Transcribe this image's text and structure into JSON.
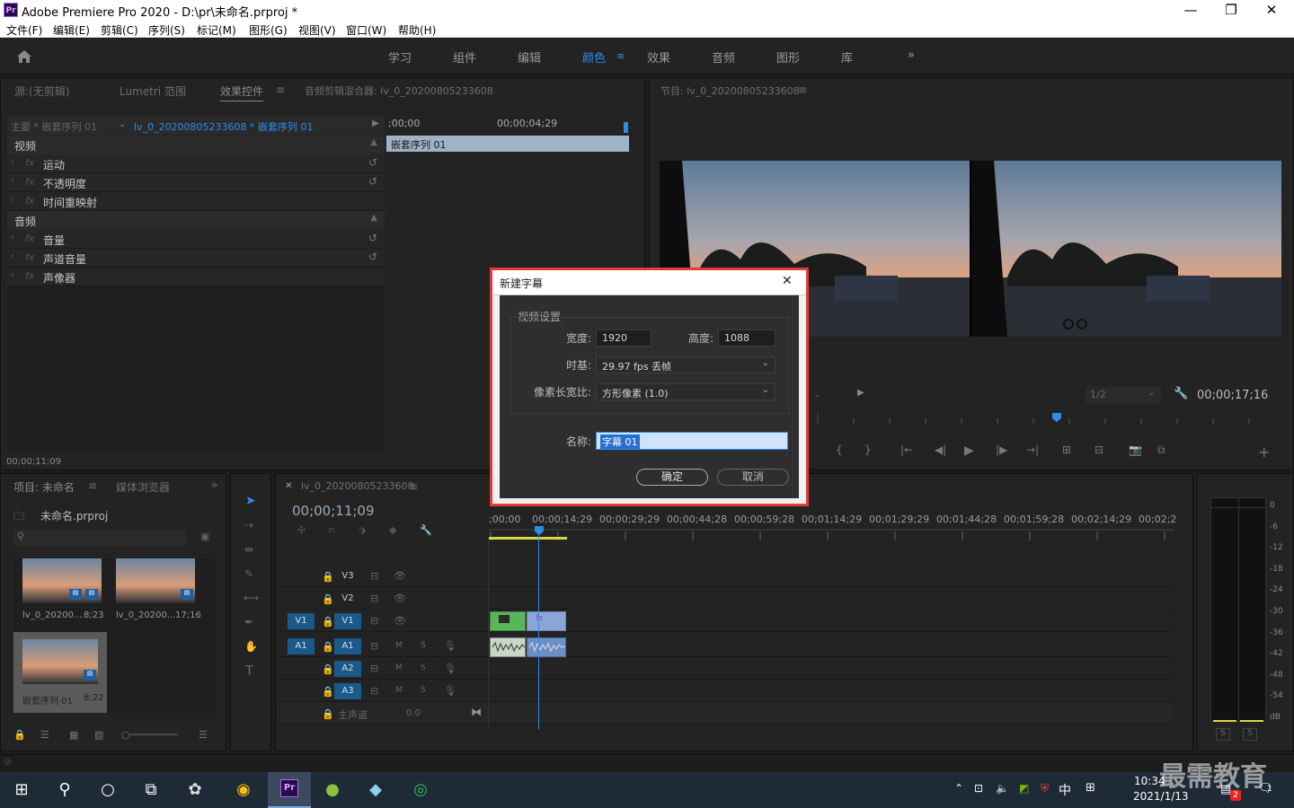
{
  "window": {
    "app_icon": "Pr",
    "title": "Adobe Premiere Pro 2020 - D:\\pr\\未命名.prproj *",
    "minimize": "—",
    "restore": "❐",
    "close": "✕"
  },
  "menu": [
    "文件(F)",
    "编辑(E)",
    "剪辑(C)",
    "序列(S)",
    "标记(M)",
    "图形(G)",
    "视图(V)",
    "窗口(W)",
    "帮助(H)"
  ],
  "workspaces": {
    "home_icon": "home-icon",
    "items": [
      "学习",
      "组件",
      "编辑",
      "颜色",
      "效果",
      "音频",
      "图形",
      "库"
    ],
    "active": "颜色",
    "more": "»"
  },
  "source_panel": {
    "tabs": [
      "源:(无剪辑)",
      "Lumetri 范围",
      "效果控件",
      "音频剪辑混合器: lv_0_20200805233608"
    ],
    "active_tab": "效果控件",
    "master_label": "主要 * 嵌套序列 01",
    "clip_label": "lv_0_20200805233608 * 嵌套序列 01",
    "time_start": ";00;00",
    "time_end": "00;00;04;29",
    "clip_bar": "嵌套序列 01",
    "video_section": "视频",
    "video_effects": [
      "运动",
      "不透明度",
      "时间重映射"
    ],
    "audio_section": "音频",
    "audio_effects": [
      "音量",
      "声道音量",
      "声像器"
    ],
    "fx_label": "fx",
    "timecode": "00;00;11;09"
  },
  "program_panel": {
    "tab": "节目: lv_0_20200805233608",
    "timecode": "00;00;17;16",
    "zoom": "1/2"
  },
  "project_panel": {
    "tabs": [
      "项目: 未命名",
      "媒体浏览器"
    ],
    "project_file": "未命名.prproj",
    "items": [
      {
        "name": "lv_0_20200...",
        "duration": "8;23"
      },
      {
        "name": "lv_0_20200...",
        "duration": "17;16"
      },
      {
        "name": "嵌套序列 01",
        "duration": "8;22"
      }
    ]
  },
  "timeline": {
    "tab": "lv_0_20200805233608",
    "timecode": "00;00;11;09",
    "ruler": [
      ";00;00",
      "00;00;14;29",
      "00;00;29;29",
      "00;00;44;28",
      "00;00;59;28",
      "00;01;14;29",
      "00;01;29;29",
      "00;01;44;28",
      "00;01;59;28",
      "00;02;14;29",
      "00;02;2"
    ],
    "tracks": [
      "V3",
      "V2",
      "V1",
      "A1",
      "A2",
      "A3"
    ],
    "source_patch_v": "V1",
    "source_patch_a": "A1",
    "master": "主声道",
    "master_val": "0.0",
    "m_label": "M",
    "s_label": "S"
  },
  "meter": {
    "scale": [
      "0",
      "-6",
      "-12",
      "-18",
      "-24",
      "-30",
      "-36",
      "-42",
      "-48",
      "-54",
      "dB"
    ],
    "solo": "S"
  },
  "dialog": {
    "title": "新建字幕",
    "close": "✕",
    "group": "视频设置",
    "width_label": "宽度:",
    "width_value": "1920",
    "height_label": "高度:",
    "height_value": "1088",
    "timebase_label": "时基:",
    "timebase_value": "29.97 fps 丢帧",
    "par_label": "像素长宽比:",
    "par_value": "方形像素 (1.0)",
    "name_label": "名称:",
    "name_value": "字幕 01",
    "ok": "确定",
    "cancel": "取消"
  },
  "taskbar": {
    "ime": "中",
    "time": "10:34",
    "date": "2021/1/13",
    "badge": "2",
    "notif": "1",
    "watermark": "最需教育"
  }
}
